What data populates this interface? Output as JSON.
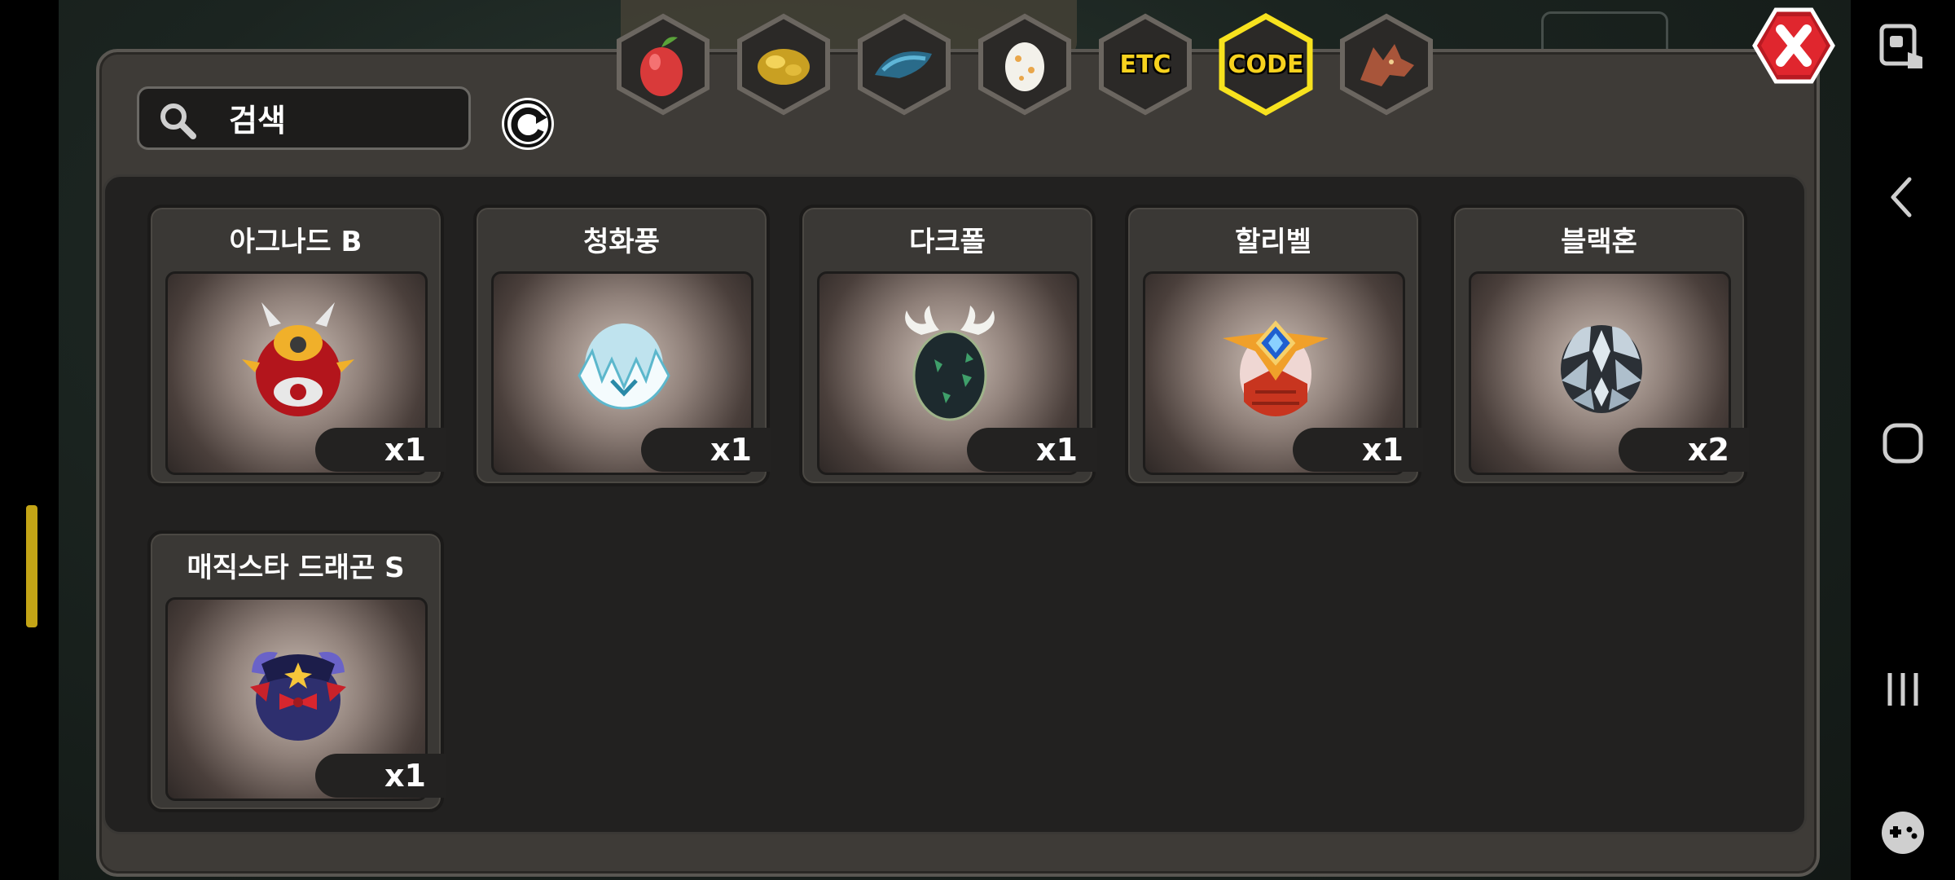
{
  "search": {
    "placeholder": "검색"
  },
  "tabs": [
    {
      "name": "fruit",
      "label": ""
    },
    {
      "name": "gold-ore",
      "label": ""
    },
    {
      "name": "blue-scale",
      "label": ""
    },
    {
      "name": "egg",
      "label": ""
    },
    {
      "name": "etc",
      "label": "ETC"
    },
    {
      "name": "code",
      "label": "CODE",
      "selected": true
    },
    {
      "name": "dragon",
      "label": ""
    }
  ],
  "items": [
    {
      "name": "아그나드 B",
      "count": "x1",
      "egg": "agnad"
    },
    {
      "name": "청화풍",
      "count": "x1",
      "egg": "cheonghwapung"
    },
    {
      "name": "다크폴",
      "count": "x1",
      "egg": "darkpol"
    },
    {
      "name": "할리벨",
      "count": "x1",
      "egg": "halibel"
    },
    {
      "name": "블랙혼",
      "count": "x2",
      "egg": "blackhorn"
    },
    {
      "name": "매직스타 드래곤 S",
      "count": "x1",
      "egg": "magicstar"
    }
  ],
  "colors": {
    "accent": "#f7d21e",
    "panel": "#3e3b37",
    "close": "#d92028"
  }
}
